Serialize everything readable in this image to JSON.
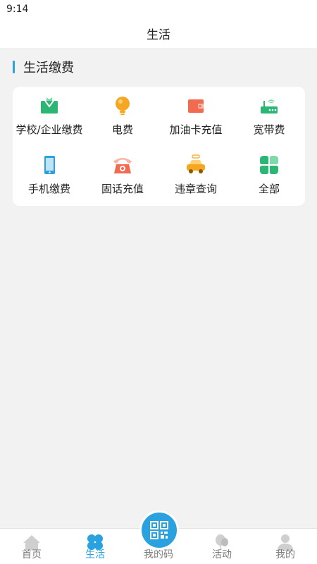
{
  "status": {
    "time": "9:14"
  },
  "header": {
    "title": "生活"
  },
  "section": {
    "title": "生活缴费"
  },
  "services": [
    {
      "label": "学校/企业缴费",
      "icon": "school-payment-icon",
      "color": "#2bb673"
    },
    {
      "label": "电费",
      "icon": "lightbulb-icon",
      "color": "#f5a623"
    },
    {
      "label": "加油卡充值",
      "icon": "wallet-icon",
      "color": "#f26b50"
    },
    {
      "label": "宽带费",
      "icon": "router-icon",
      "color": "#2bb673"
    },
    {
      "label": "手机缴费",
      "icon": "mobile-phone-icon",
      "color": "#2aa2e0"
    },
    {
      "label": "固话充值",
      "icon": "telephone-icon",
      "color": "#f26b50"
    },
    {
      "label": "违章查询",
      "icon": "car-icon",
      "color": "#f5a623"
    },
    {
      "label": "全部",
      "icon": "clover-icon",
      "color": "#2bb673"
    }
  ],
  "tabs": [
    {
      "label": "首页",
      "icon": "home-icon"
    },
    {
      "label": "生活",
      "icon": "clover-icon",
      "active": true
    },
    {
      "label": "我的码",
      "icon": "qr-code-icon"
    },
    {
      "label": "活动",
      "icon": "balloon-icon"
    },
    {
      "label": "我的",
      "icon": "user-icon"
    }
  ],
  "colors": {
    "accent": "#2aa2e0",
    "background": "#f2f2f2"
  }
}
